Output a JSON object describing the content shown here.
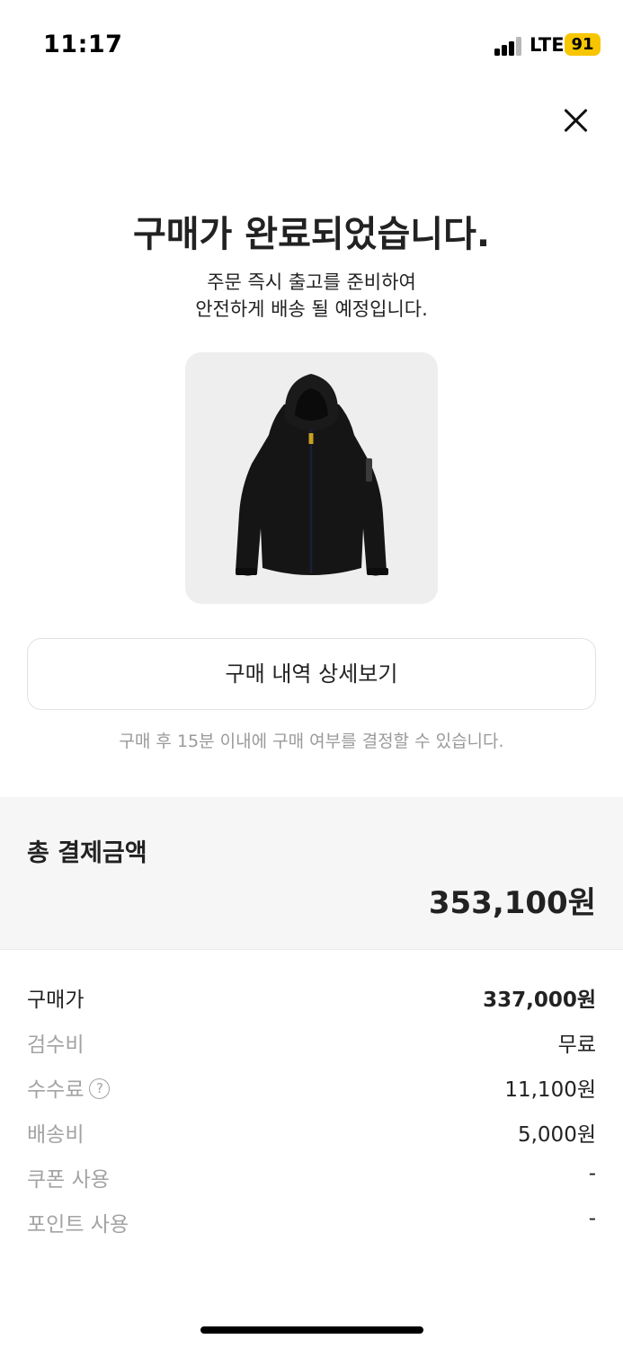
{
  "status_bar": {
    "time": "11:17",
    "network": "LTE",
    "battery": "91"
  },
  "header": {
    "title": "구매가 완료되었습니다.",
    "subtitle_line1": "주문 즉시 출고를 준비하여",
    "subtitle_line2": "안전하게 배송 될 예정입니다."
  },
  "product": {
    "image_icon": "black-hooded-jacket"
  },
  "detail_button_label": "구매 내역 상세보기",
  "notice": "구매 후 15분 이내에 구매 여부를 결정할 수 있습니다.",
  "total": {
    "label": "총 결제금액",
    "value": "353,100원"
  },
  "breakdown": [
    {
      "label": "구매가",
      "value": "337,000원"
    },
    {
      "label": "검수비",
      "value": "무료"
    },
    {
      "label": "수수료",
      "value": "11,100원",
      "help": "?"
    },
    {
      "label": "배송비",
      "value": "5,000원"
    },
    {
      "label": "쿠폰 사용",
      "value": "-"
    },
    {
      "label": "포인트 사용",
      "value": "-"
    }
  ],
  "colors": {
    "accent_battery": "#f7c600",
    "muted_text": "#a3a3a3",
    "panel_bg": "#f6f6f6"
  }
}
